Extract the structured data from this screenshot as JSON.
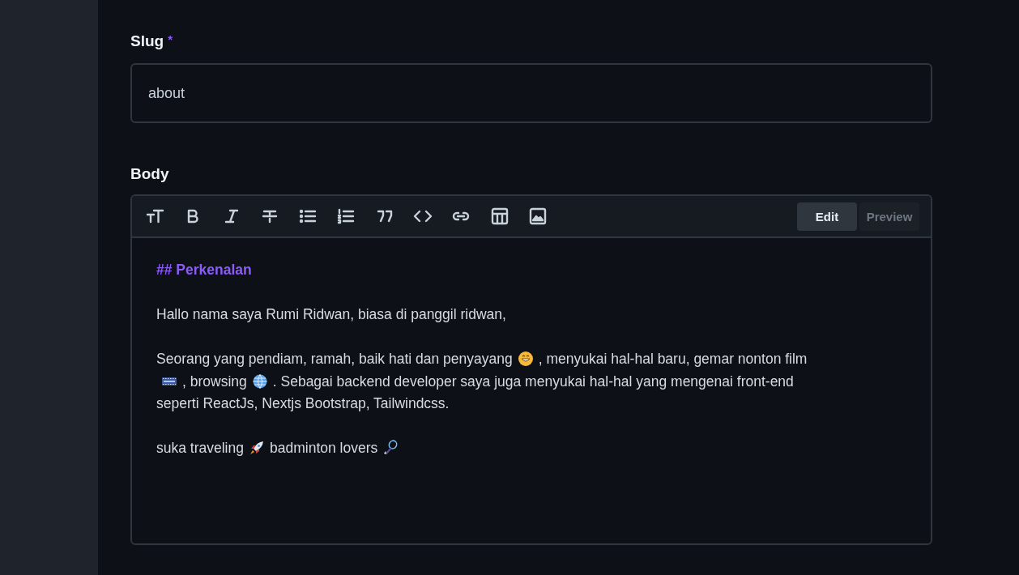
{
  "slug": {
    "label": "Slug",
    "required_mark": "*",
    "value": "about"
  },
  "body": {
    "label": "Body",
    "tabs": [
      {
        "label": "Edit",
        "selected": true
      },
      {
        "label": "Preview",
        "selected": false
      }
    ],
    "lines": [
      {
        "kind": "heading",
        "rows": [
          [
            {
              "kind": "text",
              "text": "## Perkenalan"
            }
          ]
        ]
      },
      {
        "kind": "paragraph",
        "rows": [
          [
            {
              "kind": "text",
              "text": "Hallo nama saya Rumi Ridwan, biasa di panggil ridwan,"
            }
          ]
        ]
      },
      {
        "kind": "paragraph",
        "rows": [
          [
            {
              "kind": "text",
              "text": "Seorang yang pendiam, ramah, baik hati dan penyayang"
            },
            {
              "kind": "grin"
            },
            {
              "kind": "text",
              "text": ", menyukai hal-hal baru, gemar nonton film"
            }
          ],
          [
            {
              "kind": "film"
            },
            {
              "kind": "text",
              "text": ", browsing"
            },
            {
              "kind": "globe"
            },
            {
              "kind": "text",
              "text": ". Sebagai backend developer saya juga menyukai hal-hal yang mengenai front-end"
            }
          ],
          [
            {
              "kind": "text",
              "text": "seperti ReactJs, Nextjs Bootstrap, Tailwindcss."
            }
          ]
        ]
      },
      {
        "kind": "paragraph",
        "rows": [
          [
            {
              "kind": "text",
              "text": "suka traveling"
            },
            {
              "kind": "rocket"
            },
            {
              "kind": "text",
              "text": "badminton lovers"
            },
            {
              "kind": "racket"
            }
          ]
        ]
      }
    ]
  }
}
